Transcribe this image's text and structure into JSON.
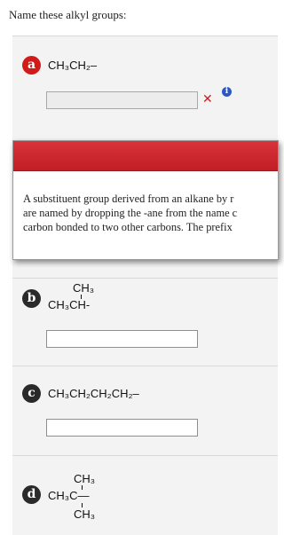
{
  "instructions": "Name these alkyl groups:",
  "items": [
    {
      "badge": "a",
      "formula": "CH₃CH₂–",
      "answer_value": "",
      "status": "incorrect"
    },
    {
      "badge": "b",
      "formula_top": "CH₃",
      "formula_main": "CH₃CH-",
      "answer_value": ""
    },
    {
      "badge": "c",
      "formula": "CH₃CH₂CH₂CH₂–",
      "answer_value": ""
    },
    {
      "badge": "d",
      "formula_top": "CH₃",
      "formula_main": "CH₃C—",
      "formula_bottom": "CH₃"
    }
  ],
  "feedback": {
    "lines": [
      "A substituent group derived from an alkane by r",
      "are named by dropping the -ane from the name c",
      "carbon bonded to two other carbons. The prefix"
    ]
  },
  "icons": {
    "incorrect": "x-mark-icon",
    "info": "info-icon"
  },
  "colors": {
    "error": "#d11a1a",
    "info": "#2b57c9",
    "badge_dark": "#2a2a2a"
  }
}
